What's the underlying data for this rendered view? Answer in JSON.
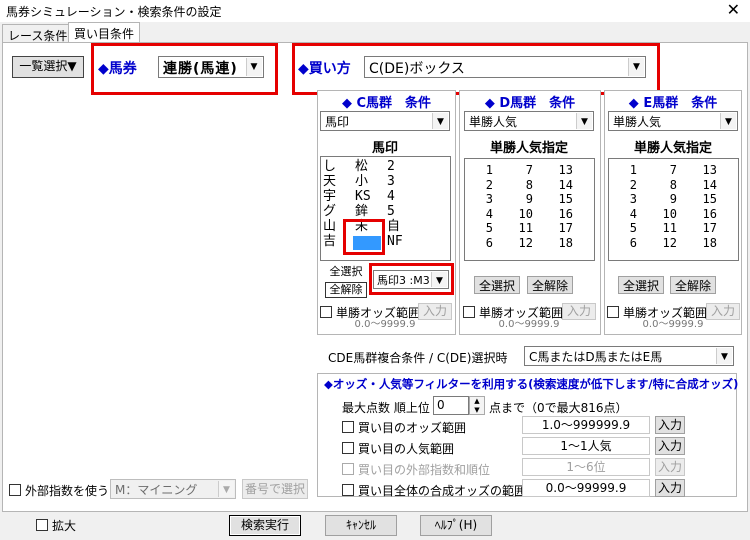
{
  "window": {
    "title": "馬券シミュレーション・検索条件の設定",
    "close": "✕"
  },
  "tabs": [
    {
      "label": "レース条件"
    },
    {
      "label": "買い目条件"
    }
  ],
  "toolbar": {
    "list_select": "一覧選択▼",
    "baken_label": "◆馬券",
    "baken_value": "連勝(馬連)",
    "kaikata_label": "◆買い方",
    "kaikata_value": "C(DE)ボックス"
  },
  "groups": {
    "c": {
      "title": "◆ C馬群　条件",
      "select": "馬印",
      "list_title": "馬印",
      "rows": [
        [
          "し",
          "松",
          "2"
        ],
        [
          "天",
          "小",
          "3"
        ],
        [
          "宇",
          "KS",
          "4"
        ],
        [
          "グ",
          "鉾",
          "5"
        ],
        [
          "山",
          "未",
          "自"
        ],
        [
          "吉",
          "",
          "NF"
        ]
      ],
      "select_all": "全選択",
      "clear_all": "全解除",
      "mark_combo": "馬印3 :M3",
      "odds_label": "単勝オッズ範囲",
      "input": "入力",
      "odds_value": "0.0～9999.9"
    },
    "d": {
      "title": "◆ D馬群　条件",
      "select": "単勝人気",
      "list_title": "単勝人気指定",
      "select_all": "全選択",
      "clear_all": "全解除",
      "odds_label": "単勝オッズ範囲",
      "input": "入力",
      "odds_value": "0.0～9999.9"
    },
    "e": {
      "title": "◆ E馬群　条件",
      "select": "単勝人気",
      "list_title": "単勝人気指定",
      "select_all": "全選択",
      "clear_all": "全解除",
      "odds_label": "単勝オッズ範囲",
      "input": "入力",
      "odds_value": "0.0～9999.9"
    }
  },
  "ninki_numbers": [
    [
      "1",
      "7",
      "13"
    ],
    [
      "2",
      "8",
      "14"
    ],
    [
      "3",
      "9",
      "15"
    ],
    [
      "4",
      "10",
      "16"
    ],
    [
      "5",
      "11",
      "17"
    ],
    [
      "6",
      "12",
      "18"
    ]
  ],
  "composite": {
    "label": "CDE馬群複合条件 / C(DE)選択時",
    "value": "C馬またはD馬またはE馬"
  },
  "filter": {
    "title": "◆オッズ・人気等フィルターを利用する(検索速度が低下します/特に合成オッズ)",
    "max_label": "最大点数 順上位",
    "max_value": "0",
    "max_suffix": "点まで（0で最大816点）",
    "rows": [
      {
        "label": "買い目のオッズ範囲",
        "value": "1.0～999999.9",
        "button": "入力"
      },
      {
        "label": "買い目の人気範囲",
        "value": "1～1人気",
        "button": "入力"
      },
      {
        "label": "買い目の外部指数和順位",
        "value": "1～6位",
        "button": "入力"
      },
      {
        "label": "買い目全体の合成オッズの範囲",
        "value": "0.0～99999.9",
        "button": "入力"
      }
    ]
  },
  "external": {
    "label": "外部指数を使う",
    "value": "M：マイニング",
    "button": "番号で選択"
  },
  "footer": {
    "zoom": "拡大",
    "search": "検索実行",
    "cancel": "ｷｬﾝｾﾙ",
    "help": "ﾍﾙﾌﾟ(H)"
  }
}
